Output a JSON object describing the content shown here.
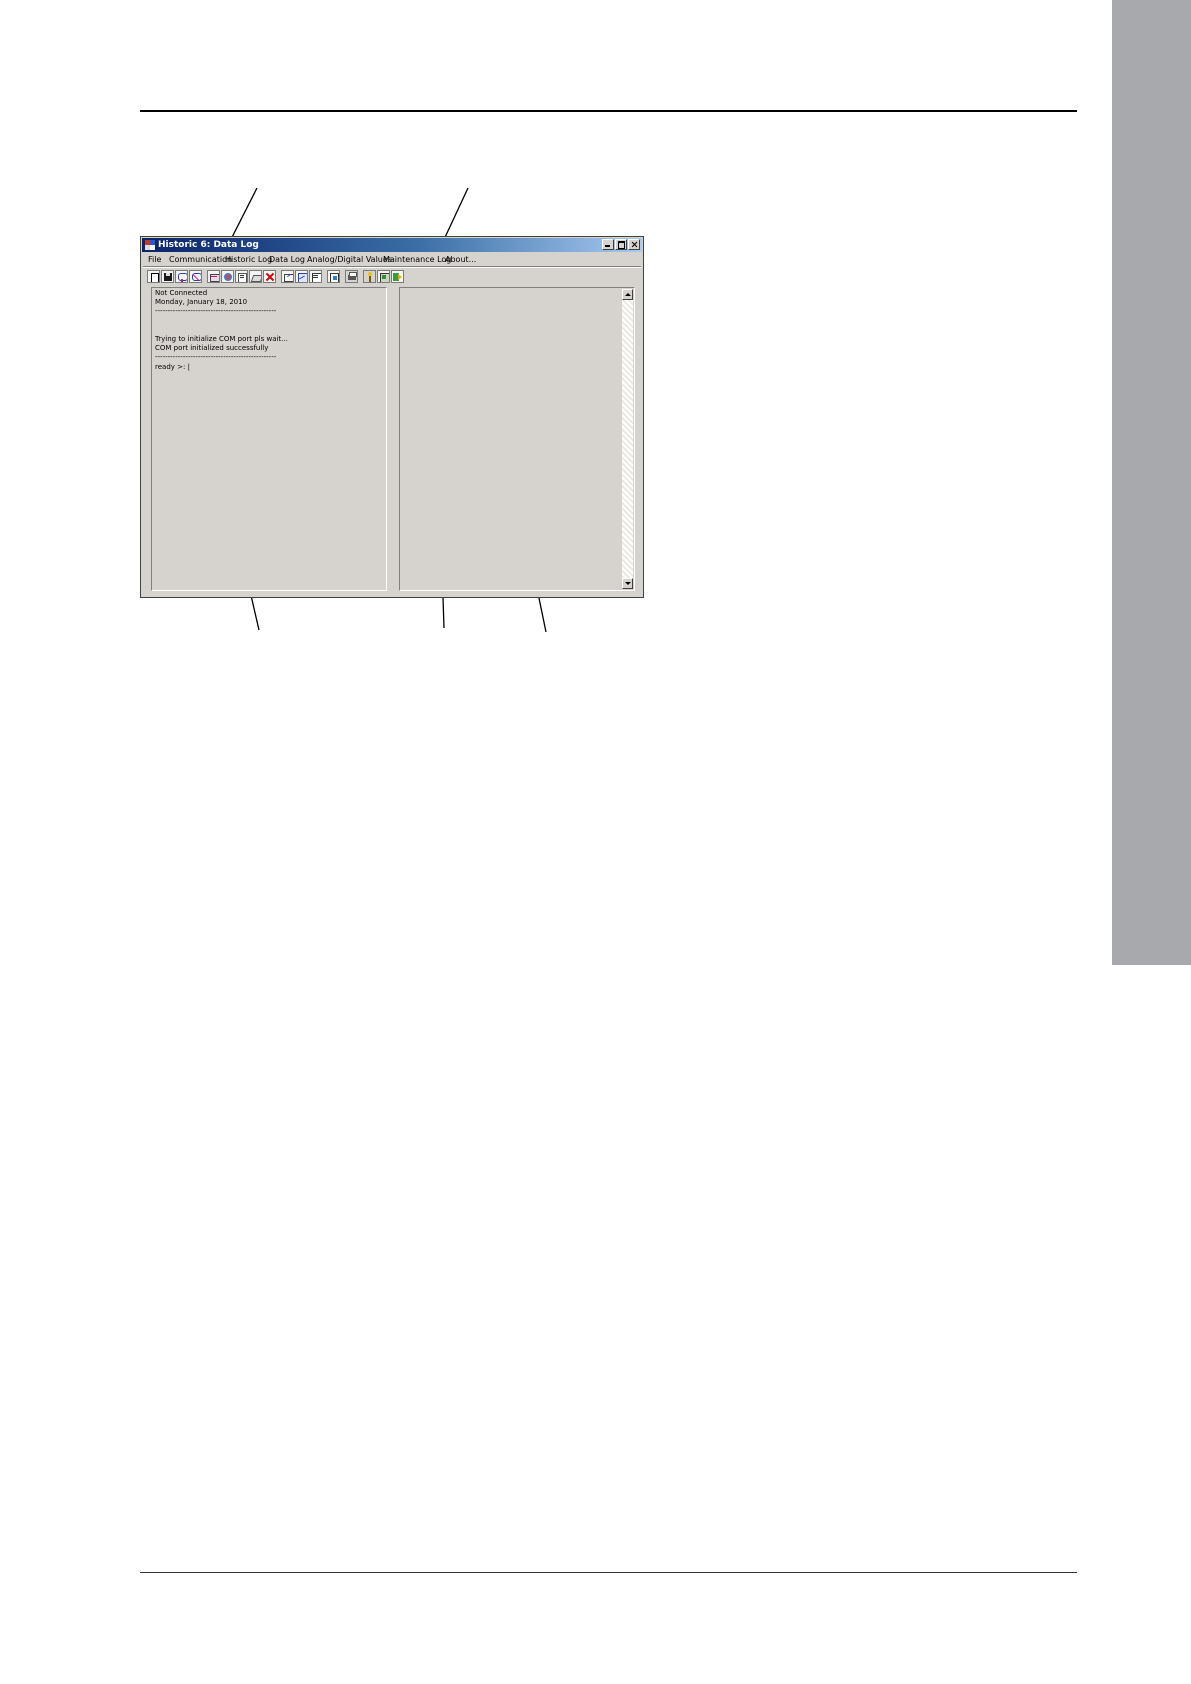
{
  "window": {
    "title": "Historic 6: Data Log",
    "menu": [
      "File",
      "Communication",
      "Historic Log",
      "Data Log",
      "Analog/Digital Values",
      "Maintenance Log",
      "About..."
    ]
  },
  "toolbar": {
    "buttons": [
      "new-file-icon",
      "save-icon",
      "connect-icon",
      "disconnect-icon",
      "historic-log-icon",
      "data-log-icon",
      "analog-values-icon",
      "maintenance-icon",
      "delete-icon",
      "export-icon",
      "graph-icon",
      "report-icon",
      "convert-icon",
      "print-icon",
      "help-icon",
      "settings-icon",
      "exit-icon"
    ]
  },
  "console": {
    "lines": [
      "Not Connected",
      "Monday, January 18, 2010",
      "------------------------------------------------",
      "",
      "",
      "Trying to initialize COM port pls wait...",
      "COM port initialized successfully",
      "------------------------------------------------",
      "ready >: |"
    ]
  },
  "colors": {
    "window_bg": "#d6d3ce",
    "title_active": "#0a246a",
    "side_tab": "#a8a9ad"
  }
}
